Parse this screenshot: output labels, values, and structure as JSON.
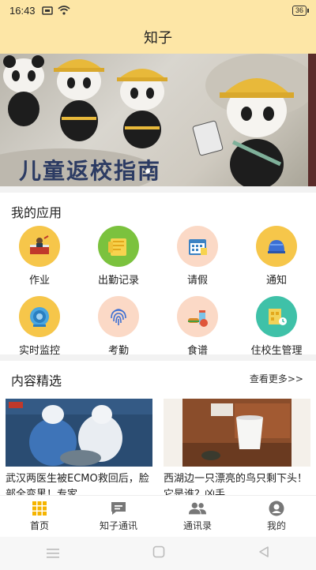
{
  "status": {
    "time": "16:43",
    "battery": "36"
  },
  "header": {
    "title": "知子"
  },
  "banner": {
    "text": "儿童返校指南"
  },
  "apps": {
    "title": "我的应用",
    "items": [
      {
        "label": "作业",
        "icon": "homework-icon",
        "bg": "#f6c64a"
      },
      {
        "label": "出勤记录",
        "icon": "attendance-record-icon",
        "bg": "#7bc23e"
      },
      {
        "label": "请假",
        "icon": "leave-calendar-icon",
        "bg": "#fbd9c6"
      },
      {
        "label": "通知",
        "icon": "notification-bell-icon",
        "bg": "#f6c64a"
      },
      {
        "label": "实时监控",
        "icon": "monitor-camera-icon",
        "bg": "#f6c64a"
      },
      {
        "label": "考勤",
        "icon": "fingerprint-icon",
        "bg": "#fbd9c6"
      },
      {
        "label": "食谱",
        "icon": "recipe-food-icon",
        "bg": "#fbd9c6"
      },
      {
        "label": "住校生管理",
        "icon": "boarding-student-icon",
        "bg": "#3fc1a8"
      }
    ]
  },
  "content": {
    "title": "内容精选",
    "more": "查看更多>>",
    "articles": [
      {
        "title": "武汉两医生被ECMO救回后，脸部全变黑！专家..."
      },
      {
        "title": "西湖边一只漂亮的鸟只剩下头！它是谁？凶手..."
      }
    ]
  },
  "tabs": [
    {
      "label": "首页",
      "icon": "home-grid-icon",
      "active": true
    },
    {
      "label": "知子通讯",
      "icon": "chat-icon",
      "active": false
    },
    {
      "label": "通讯录",
      "icon": "contacts-icon",
      "active": false
    },
    {
      "label": "我的",
      "icon": "profile-icon",
      "active": false
    }
  ],
  "colors": {
    "accent": "#fde6a6",
    "active_tab": "#f5b400"
  }
}
